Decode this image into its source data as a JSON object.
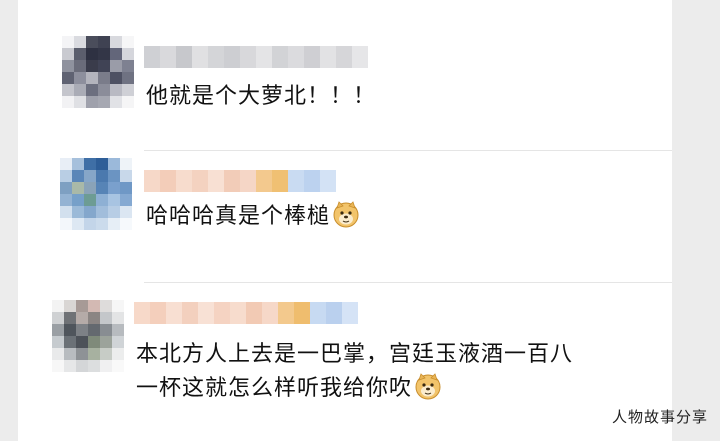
{
  "comments": [
    {
      "text": "他就是个大萝北！！！",
      "emoji": ""
    },
    {
      "text": "哈哈哈真是个棒槌",
      "emoji": "doge-emoji"
    },
    {
      "line1": "本北方人上去是一巴掌，宫廷玉液酒一百八",
      "line2": "一杯这就怎么样听我给你吹",
      "emoji": "doge-emoji"
    }
  ],
  "watermark": "人物故事分享",
  "colors": {
    "background": "#ececec",
    "card": "#ffffff",
    "divider": "#e5e5e5",
    "text": "#111111"
  }
}
